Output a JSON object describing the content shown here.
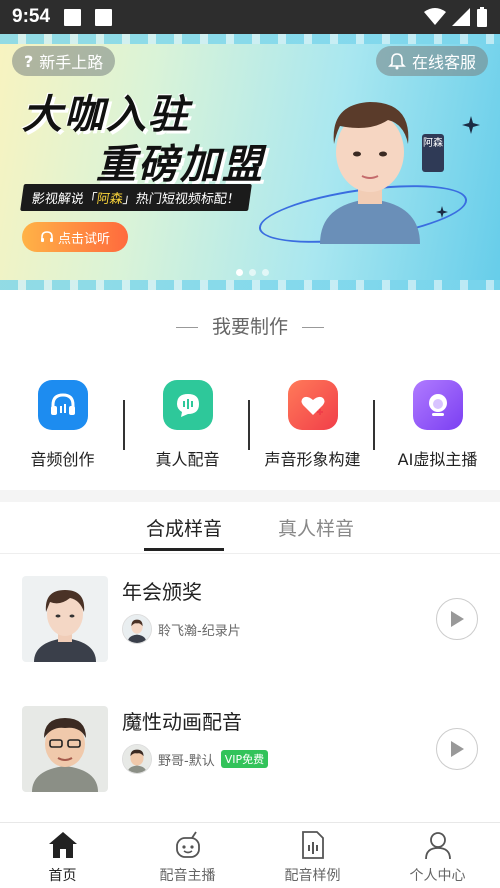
{
  "status_bar": {
    "time": "9:54"
  },
  "banner": {
    "left_pill": "新手上路",
    "right_pill": "在线客服",
    "title_line1": "大咖入驻",
    "title_line2": "重磅加盟",
    "subtitle_pre": "影视解说「",
    "subtitle_highlight": "阿森",
    "subtitle_post": "」热门短视频标配！",
    "try_button": "点击试听",
    "tag": "阿森",
    "page_index": 1,
    "page_count": 3
  },
  "make_section": {
    "title": "我要制作",
    "tools": [
      {
        "label": "音频创作",
        "icon": "headphones-icon"
      },
      {
        "label": "真人配音",
        "icon": "chat-bubble-icon"
      },
      {
        "label": "声音形象构建",
        "icon": "heart-add-icon"
      },
      {
        "label": "AI虚拟主播",
        "icon": "avatar-head-icon"
      }
    ]
  },
  "tabs": [
    {
      "label": "合成样音",
      "active": true
    },
    {
      "label": "真人样音",
      "active": false
    }
  ],
  "samples": [
    {
      "title": "年会颁奖",
      "voice": "聆飞瀚-纪录片",
      "vip": ""
    },
    {
      "title": "魔性动画配音",
      "voice": "野哥-默认",
      "vip": "VIP免费"
    }
  ],
  "bottom_nav": [
    {
      "label": "首页",
      "icon": "home-icon",
      "active": true
    },
    {
      "label": "配音主播",
      "icon": "robot-icon",
      "active": false
    },
    {
      "label": "配音样例",
      "icon": "audio-file-icon",
      "active": false
    },
    {
      "label": "个人中心",
      "icon": "user-icon",
      "active": false
    }
  ],
  "colors": {
    "accent": "#1d8cf0",
    "green": "#2ec89a",
    "vip": "#32c35a"
  }
}
